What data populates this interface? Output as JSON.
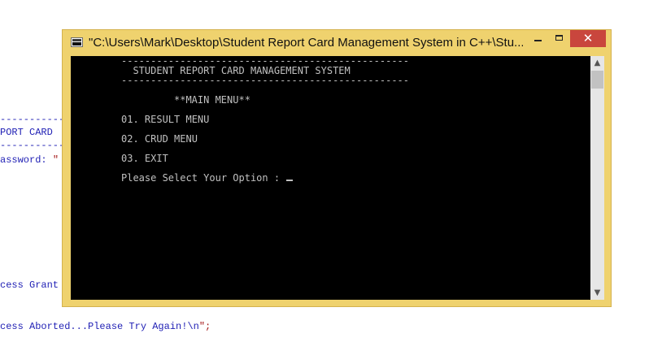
{
  "background_code": {
    "line1": "-----------",
    "line2": "PORT CARD",
    "line3": "-----------",
    "line4_prefix": "assword: ",
    "line4_string": "\"",
    "line5": "cess Grant",
    "line6_prefix": "cess Aborted...Please Try Again!\\n",
    "line6_suffix": "\";"
  },
  "window": {
    "title": "\"C:\\Users\\Mark\\Desktop\\Student Report Card Management System in C++\\Stu...",
    "close_glyph": "✕"
  },
  "console": {
    "rule_top": "-------------------------------------------------",
    "heading": "  STUDENT REPORT CARD MANAGEMENT SYSTEM",
    "rule_bottom": "-------------------------------------------------",
    "menu_title": "**MAIN MENU**",
    "option_1": "01. RESULT MENU",
    "option_2": "02. CRUD MENU",
    "option_3": "03. EXIT",
    "prompt": "Please Select Your Option : "
  },
  "scrollbar": {
    "up_glyph": "▲",
    "down_glyph": "▼"
  },
  "colors": {
    "window_frame": "#efd26e",
    "close_button": "#c9463d",
    "console_bg": "#000000",
    "console_fg": "#c0c0c0",
    "code_text": "#1e1eb4"
  }
}
